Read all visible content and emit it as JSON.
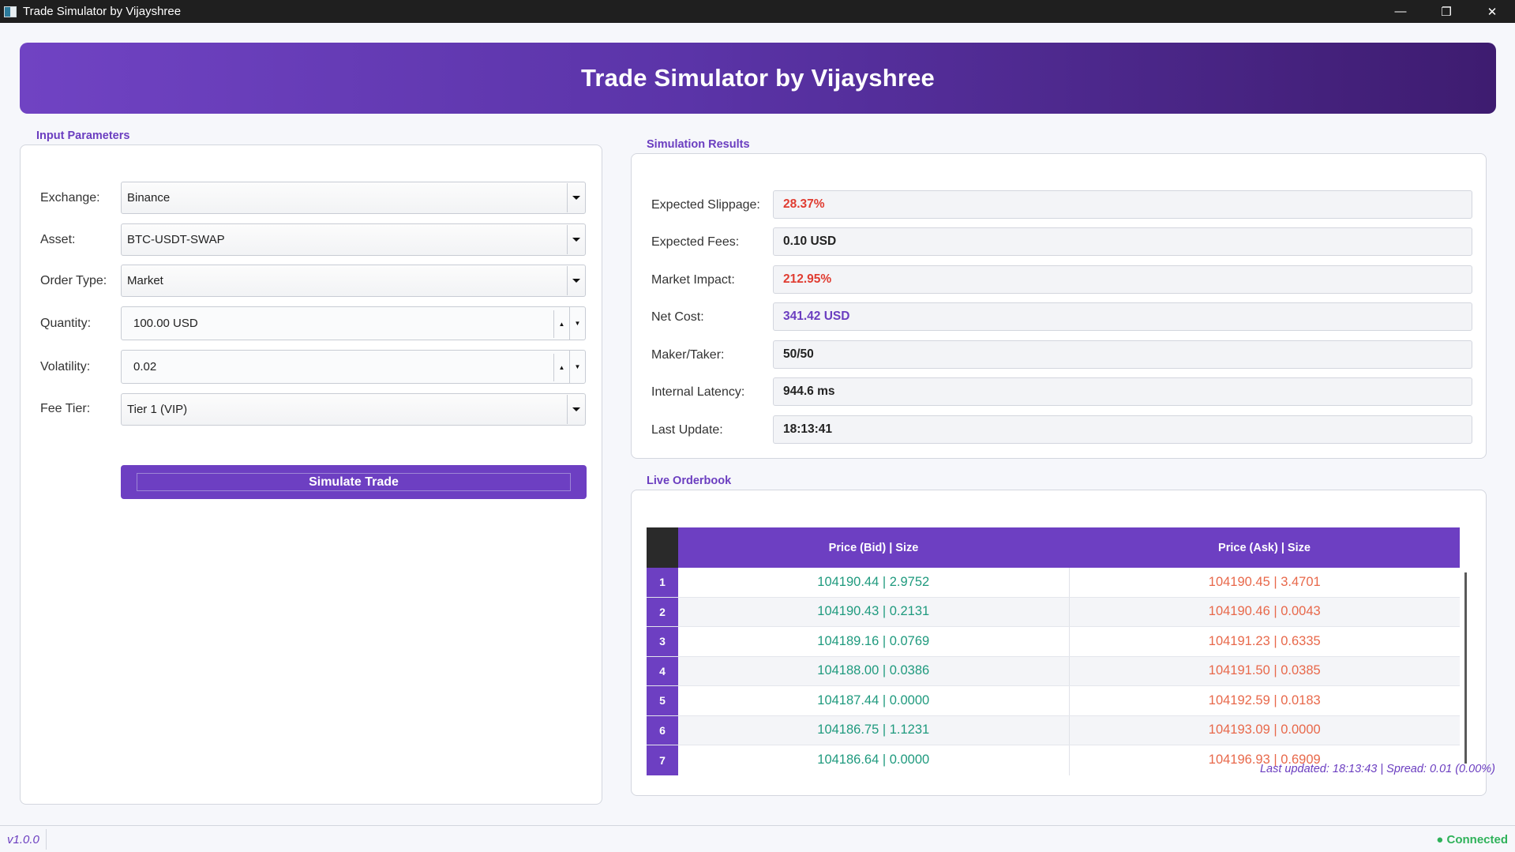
{
  "window": {
    "title": "Trade Simulator by Vijayshree",
    "controls": {
      "minimize": "—",
      "restore": "❐",
      "close": "✕"
    }
  },
  "header": {
    "title": "Trade Simulator by Vijayshree"
  },
  "input_panel": {
    "title": "Input Parameters",
    "fields": {
      "exchange": {
        "label": "Exchange:",
        "value": "Binance"
      },
      "asset": {
        "label": "Asset:",
        "value": "BTC-USDT-SWAP"
      },
      "order_type": {
        "label": "Order Type:",
        "value": "Market"
      },
      "quantity": {
        "label": "Quantity:",
        "value": "100.00 USD"
      },
      "volatility": {
        "label": "Volatility:",
        "value": "0.02"
      },
      "fee_tier": {
        "label": "Fee Tier:",
        "value": "Tier 1 (VIP)"
      }
    },
    "simulate_label": "Simulate Trade"
  },
  "results_panel": {
    "title": "Simulation Results",
    "rows": {
      "slippage": {
        "label": "Expected Slippage:",
        "value": "28.37%"
      },
      "fees": {
        "label": "Expected Fees:",
        "value": "0.10 USD"
      },
      "impact": {
        "label": "Market Impact:",
        "value": "212.95%"
      },
      "net_cost": {
        "label": "Net Cost:",
        "value": "341.42 USD"
      },
      "maker_taker": {
        "label": "Maker/Taker:",
        "value": "50/50"
      },
      "latency": {
        "label": "Internal Latency:",
        "value": "944.6 ms"
      },
      "last_update": {
        "label": "Last Update:",
        "value": "18:13:41"
      }
    }
  },
  "orderbook": {
    "title": "Live Orderbook",
    "headers": {
      "bid": "Price (Bid) | Size",
      "ask": "Price (Ask) | Size"
    },
    "rows": [
      {
        "index": "1",
        "bid": "104190.44 | 2.9752",
        "ask": "104190.45 | 3.4701"
      },
      {
        "index": "2",
        "bid": "104190.43 | 0.2131",
        "ask": "104190.46 | 0.0043"
      },
      {
        "index": "3",
        "bid": "104189.16 | 0.0769",
        "ask": "104191.23 | 0.6335"
      },
      {
        "index": "4",
        "bid": "104188.00 | 0.0386",
        "ask": "104191.50 | 0.0385"
      },
      {
        "index": "5",
        "bid": "104187.44 | 0.0000",
        "ask": "104192.59 | 0.0183"
      },
      {
        "index": "6",
        "bid": "104186.75 | 1.1231",
        "ask": "104193.09 | 0.0000"
      },
      {
        "index": "7",
        "bid": "104186.64 | 0.0000",
        "ask": "104196.93 | 0.6909"
      }
    ],
    "footer": "Last updated: 18:13:43 | Spread: 0.01 (0.00%)"
  },
  "status_bar": {
    "version": "v1.0.0",
    "connection": "● Connected"
  },
  "colors": {
    "accent": "#6d3fc2",
    "bid": "#1f9a7e",
    "ask": "#e8684a",
    "negative": "#e03c31",
    "connected": "#2fb25a"
  }
}
